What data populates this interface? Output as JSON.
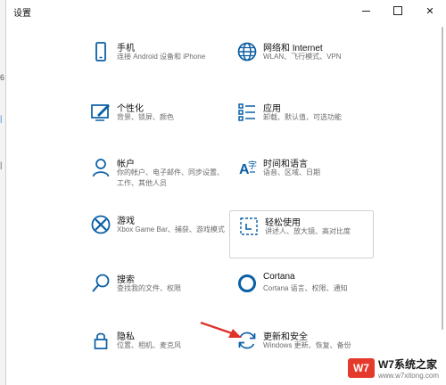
{
  "window": {
    "title": "设置",
    "controls": {
      "close": "✕"
    }
  },
  "settings": [
    {
      "title": "手机",
      "desc1": "连接 Android 设备和 iPhone",
      "desc2": "",
      "icon": "phone-icon"
    },
    {
      "title": "网络和 Internet",
      "desc1": "WLAN、飞行模式、VPN",
      "desc2": "",
      "icon": "globe-icon"
    },
    {
      "title": "个性化",
      "desc1": "背景、锁屏、颜色",
      "desc2": "",
      "icon": "paintbrush-icon"
    },
    {
      "title": "应用",
      "desc1": "卸载、默认值、可选功能",
      "desc2": "",
      "icon": "apps-list-icon"
    },
    {
      "title": "帐户",
      "desc1": "你的帐户、电子邮件、同步设置、",
      "desc2": "工作、其他人员",
      "icon": "person-icon"
    },
    {
      "title": "时间和语言",
      "desc1": "语音、区域、日期",
      "desc2": "",
      "icon": "time-language-icon"
    },
    {
      "title": "游戏",
      "desc1": "Xbox Game Bar、捕获、游戏模式",
      "desc2": "",
      "icon": "xbox-icon"
    },
    {
      "title": "轻松使用",
      "desc1": "讲述人、放大镜、高对比度",
      "desc2": "",
      "icon": "ease-of-access-icon"
    },
    {
      "title": "搜索",
      "desc1": "查找我的文件、权限",
      "desc2": "",
      "icon": "search-icon"
    },
    {
      "title": "Cortana",
      "desc1": "Cortana 语言、权限、通知",
      "desc2": "",
      "icon": "cortana-icon"
    },
    {
      "title": "隐私",
      "desc1": "位置、相机、麦克风",
      "desc2": "",
      "icon": "lock-icon"
    },
    {
      "title": "更新和安全",
      "desc1": "Windows 更新、恢复、备份",
      "desc2": "",
      "icon": "update-icon"
    }
  ],
  "watermark": {
    "logo": "W7",
    "name": "W7系统之家",
    "sub": "www.w7xitong.com"
  },
  "colors": {
    "accent": "#0b5fa5",
    "arrow": "#e0312b",
    "watermark": "#e53a2b"
  }
}
